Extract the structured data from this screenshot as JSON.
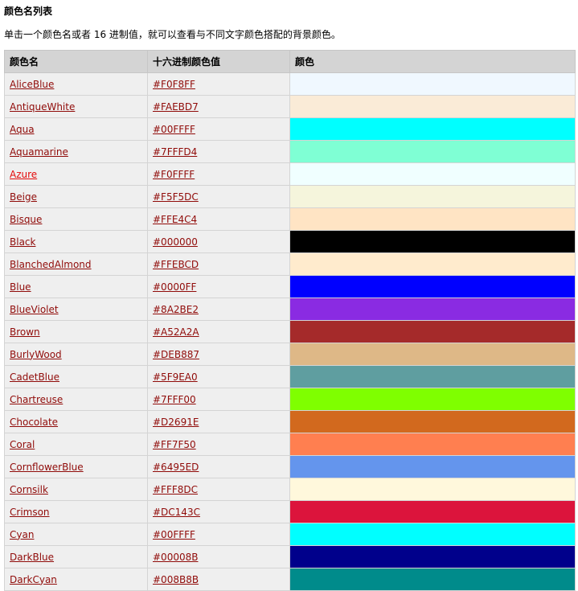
{
  "title": "颜色名列表",
  "intro": "单击一个颜色名或者 16 进制值，就可以查看与不同文字颜色搭配的背景颜色。",
  "table": {
    "headers": [
      "颜色名",
      "十六进制颜色值",
      "颜色"
    ],
    "rows": [
      {
        "name": "AliceBlue",
        "hex": "#F0F8FF"
      },
      {
        "name": "AntiqueWhite",
        "hex": "#FAEBD7"
      },
      {
        "name": "Aqua",
        "hex": "#00FFFF"
      },
      {
        "name": "Aquamarine",
        "hex": "#7FFFD4"
      },
      {
        "name": "Azure",
        "hex": "#F0FFFF",
        "highlight": true
      },
      {
        "name": "Beige",
        "hex": "#F5F5DC"
      },
      {
        "name": "Bisque",
        "hex": "#FFE4C4"
      },
      {
        "name": "Black",
        "hex": "#000000"
      },
      {
        "name": "BlanchedAlmond",
        "hex": "#FFEBCD"
      },
      {
        "name": "Blue",
        "hex": "#0000FF"
      },
      {
        "name": "BlueViolet",
        "hex": "#8A2BE2"
      },
      {
        "name": "Brown",
        "hex": "#A52A2A"
      },
      {
        "name": "BurlyWood",
        "hex": "#DEB887"
      },
      {
        "name": "CadetBlue",
        "hex": "#5F9EA0"
      },
      {
        "name": "Chartreuse",
        "hex": "#7FFF00"
      },
      {
        "name": "Chocolate",
        "hex": "#D2691E"
      },
      {
        "name": "Coral",
        "hex": "#FF7F50"
      },
      {
        "name": "CornflowerBlue",
        "hex": "#6495ED"
      },
      {
        "name": "Cornsilk",
        "hex": "#FFF8DC"
      },
      {
        "name": "Crimson",
        "hex": "#DC143C"
      },
      {
        "name": "Cyan",
        "hex": "#00FFFF"
      },
      {
        "name": "DarkBlue",
        "hex": "#00008B"
      },
      {
        "name": "DarkCyan",
        "hex": "#008B8B"
      }
    ]
  }
}
